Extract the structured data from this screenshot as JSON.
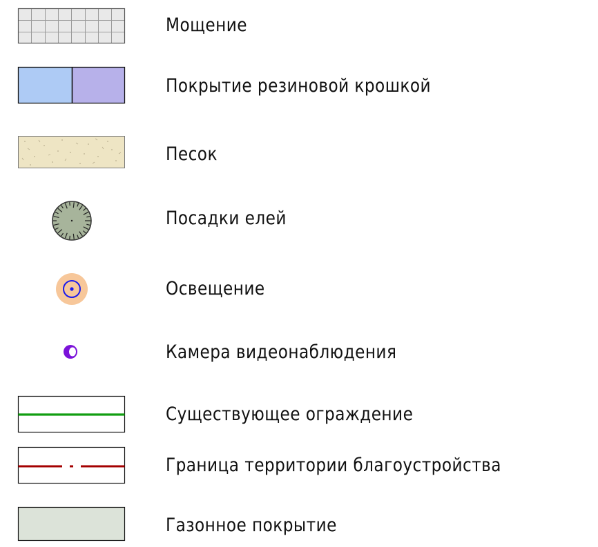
{
  "legend": {
    "items": [
      {
        "label": "Мощение",
        "icon": "paving-swatch-icon",
        "color": "#e8e8e8"
      },
      {
        "label": "Покрытие резиновой крошкой",
        "icon": "rubber-crumb-swatch-icon",
        "colors": [
          "#aecbf5",
          "#b7b1ea"
        ]
      },
      {
        "label": "Песок",
        "icon": "sand-swatch-icon",
        "color": "#eee5c4"
      },
      {
        "label": "Посадки елей",
        "icon": "spruce-planting-icon",
        "color": "#a7b49b"
      },
      {
        "label": "Освещение",
        "icon": "lighting-icon",
        "colors": [
          "#f7c79a",
          "#1a1aee"
        ]
      },
      {
        "label": "Камера видеонаблюдения",
        "icon": "cctv-camera-icon",
        "color": "#7b12d9"
      },
      {
        "label": "Существующее ограждение",
        "icon": "existing-fence-line-icon",
        "color": "#119e11"
      },
      {
        "label": "Граница территории благоустройства",
        "icon": "boundary-dash-dot-line-icon",
        "color": "#a40000"
      },
      {
        "label": "Газонное покрытие",
        "icon": "lawn-swatch-icon",
        "color": "#dce3d9"
      }
    ]
  }
}
